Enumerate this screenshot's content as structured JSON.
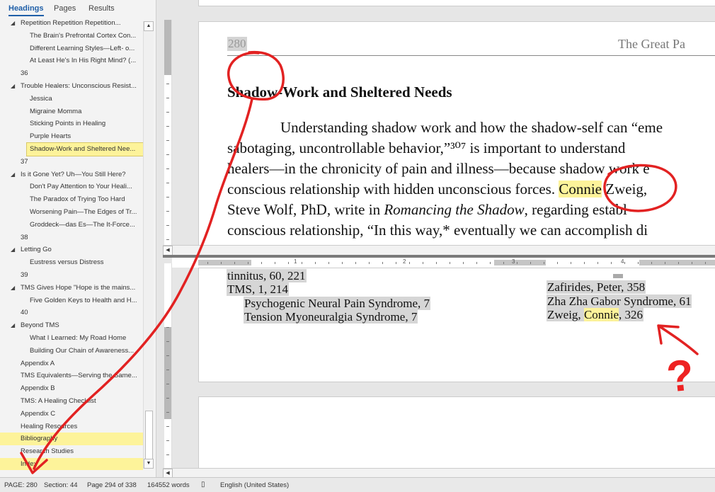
{
  "nav": {
    "tabs": [
      "Headings",
      "Pages",
      "Results"
    ],
    "items": [
      {
        "label": "Repetition Repetition Repetition...",
        "level": 1,
        "expanded": true
      },
      {
        "label": "The Brain's Prefrontal Cortex Con...",
        "level": 2
      },
      {
        "label": "Different Learning Styles—Left- o...",
        "level": 2
      },
      {
        "label": "At Least He's In His Right Mind? (...",
        "level": 2
      },
      {
        "label": "36",
        "level": 1
      },
      {
        "label": "Trouble Healers: Unconscious Resist...",
        "level": 1,
        "expanded": true
      },
      {
        "label": "Jessica",
        "level": 2
      },
      {
        "label": "Migraine Momma",
        "level": 2
      },
      {
        "label": "Sticking Points in Healing",
        "level": 2
      },
      {
        "label": "Purple Hearts",
        "level": 2
      },
      {
        "label": "Shadow-Work and Sheltered Nee...",
        "level": 2,
        "selected": true
      },
      {
        "label": "37",
        "level": 1
      },
      {
        "label": "Is it Gone Yet? Uh—You Still Here?",
        "level": 1,
        "expanded": true
      },
      {
        "label": "Don't Pay Attention to Your Heali...",
        "level": 2
      },
      {
        "label": "The Paradox of Trying Too Hard",
        "level": 2
      },
      {
        "label": "Worsening Pain—The Edges of Tr...",
        "level": 2
      },
      {
        "label": "Groddeck—das Es—The It-Force...",
        "level": 2
      },
      {
        "label": "38",
        "level": 1
      },
      {
        "label": "Letting Go",
        "level": 1,
        "expanded": true
      },
      {
        "label": "Eustress versus Distress",
        "level": 2
      },
      {
        "label": "39",
        "level": 1
      },
      {
        "label": "TMS Gives Hope \"Hope is the mains...",
        "level": 1,
        "expanded": true
      },
      {
        "label": "Five Golden Keys to Health and H...",
        "level": 2
      },
      {
        "label": "40",
        "level": 1
      },
      {
        "label": "Beyond TMS",
        "level": 1,
        "expanded": true
      },
      {
        "label": "What I Learned: My Road Home",
        "level": 2
      },
      {
        "label": "Building Our Chain of Awareness...",
        "level": 2
      },
      {
        "label": "Appendix A",
        "level": 1
      },
      {
        "label": "TMS Equivalents—Serving the Same...",
        "level": 1
      },
      {
        "label": "Appendix B",
        "level": 1
      },
      {
        "label": "TMS: A Healing Checklist",
        "level": 1
      },
      {
        "label": "Appendix C",
        "level": 1
      },
      {
        "label": "Healing Resources",
        "level": 1
      },
      {
        "label": "Bibliography",
        "level": 1,
        "highlight": true
      },
      {
        "label": "Research Studies",
        "level": 1
      },
      {
        "label": "Index",
        "level": 1,
        "highlight": true
      }
    ]
  },
  "doc": {
    "page_number": "280",
    "running_head": "The Great Pa",
    "section_title": "Shadow-Work and Sheltered Needs",
    "lines": [
      "Understanding shadow work and how the shadow-self can “eme",
      "sabotaging, uncontrollable behavior,”³⁰⁷ is important to understand",
      "healers—in the chronicity of pain and illness—because shadow work e",
      "conscious relationship with hidden unconscious forces.",
      "Connie",
      "Zweig,",
      "Steve Wolf, PhD, write in",
      "Romancing the Shadow",
      ", regarding establ",
      "conscious relationship, “In this way,* eventually we can accomplish di"
    ]
  },
  "ruler": {
    "numbers": [
      "1",
      "2",
      "3",
      "4"
    ]
  },
  "index": {
    "left": [
      "tinnitus, 60, 221",
      "TMS, 1, 214",
      "Psychogenic Neural Pain Syndrome, 7",
      "Tension Myoneuralgia Syndrome, 7"
    ],
    "right": [
      "Zafirides, Peter, 358",
      "Zha Zha Gabor Syndrome, 61"
    ],
    "zweig_prefix": "Zweig, ",
    "zweig_name": "Connie",
    "zweig_suffix": ", 326"
  },
  "status": {
    "page": "PAGE: 280",
    "section": "Section: 44",
    "page_of": "Page 294 of 338",
    "words": "164552 words",
    "language": "English (United States)"
  },
  "annotation": {
    "question_mark": "?",
    "color": "#e22222"
  },
  "colors": {
    "highlight": "#fdf39a",
    "accent": "#1f5fa8"
  }
}
